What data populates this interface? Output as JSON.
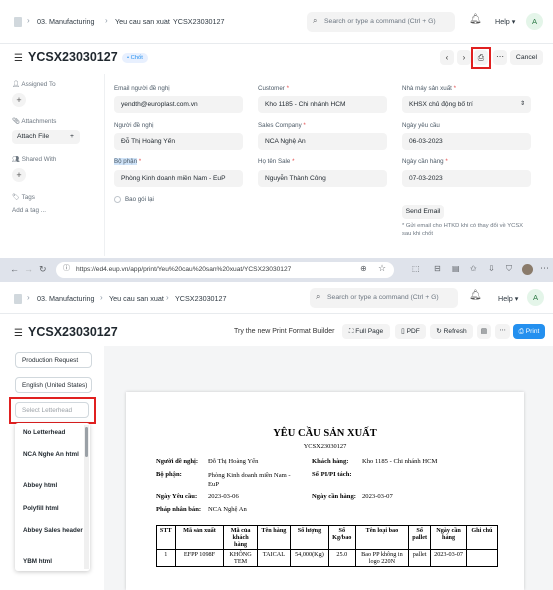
{
  "app": {
    "breadcrumbs": [
      "03. Manufacturing",
      "Yeu cau san xuat",
      "YCSX23030127"
    ],
    "search_placeholder": "Search or type a command (Ctrl + G)",
    "help_label": "Help",
    "avatar_letter": "A"
  },
  "doc": {
    "title": "YCSX23030127",
    "status_badge": "• Chốt",
    "cancel_label": "Cancel"
  },
  "sidebar": {
    "assigned_to": "Assigned To",
    "attachments": "Attachments",
    "attach_file": "Attach File",
    "shared_with": "Shared With",
    "tags": "Tags",
    "add_tag": "Add a tag ..."
  },
  "form": {
    "email_label": "Email người đề nghị",
    "email_value": "yendth@europlast.com.vn",
    "requester_label": "Người đề nghị",
    "requester_value": "Đỗ Thị Hoàng Yến",
    "department_label": "Bộ phận",
    "department_value": "Phòng Kinh doanh miền Nam - EuP",
    "include_bag_label": "Bao gói lại",
    "customer_label": "Customer",
    "customer_value": "Kho 1185 - Chi nhánh HCM",
    "sales_company_label": "Sales Company",
    "sales_company_value": "NCA Nghệ An",
    "sale_name_label": "Họ tên Sale",
    "sale_name_value": "Nguyễn Thành Công",
    "factory_label": "Nhà máy sản xuất",
    "factory_value": "KHSX chủ động bố trí",
    "request_date_label": "Ngày yêu cầu",
    "request_date_value": "06-03-2023",
    "needed_date_label": "Ngày cần hàng",
    "needed_date_value": "07-03-2023",
    "send_email_label": "Send Email",
    "note": "* Gửi email cho HTKD khi có thay đổi về YCSX sau khi chốt"
  },
  "browser": {
    "url": "https://ed4.eup.vn/app/print/Yeu%20cau%20san%20xuat/YCSX23030127"
  },
  "print_view": {
    "breadcrumbs": [
      "03. Manufacturing",
      "Yeu cau san xuat",
      "YCSX23030127"
    ],
    "search_placeholder": "Search or type a command (Ctrl + G)",
    "help_label": "Help",
    "avatar_letter": "A",
    "title": "YCSX23030127",
    "builder_note": "Try the new Print Format Builder",
    "full_page": "Full Page",
    "pdf": "PDF",
    "refresh": "Refresh",
    "print": "Print",
    "print_format_value": "Production Request",
    "language_value": "English (United States)",
    "letterhead_placeholder": "Select Letterhead",
    "letterhead_options": [
      "No Letterhead",
      "NCA Nghe An html",
      "Abbey html",
      "Polyfill html",
      "Abbey Sales header",
      "YBM html"
    ]
  },
  "preview": {
    "title": "YÊU CẦU SẢN XUẤT",
    "code": "YCSX23030127",
    "requester_label": "Người đề nghị:",
    "requester_value": "Đỗ Thị Hoàng Yến",
    "customer_label": "Khách hàng:",
    "customer_value": "Kho 1185 - Chi nhánh HCM",
    "department_label": "Bộ phận:",
    "department_value": "Phòng Kinh doanh miền Nam - EuP",
    "po_label": "Số PI/PI tách:",
    "request_date_label": "Ngày Yêu cầu:",
    "request_date_value": "2023-03-06",
    "needed_date_label": "Ngày cần hàng:",
    "needed_date_value": "2023-03-07",
    "legal_label": "Pháp nhân bán:",
    "legal_value": "NCA Nghệ An",
    "table_headers": [
      "STT",
      "Mã sản xuất",
      "Mã của khách hàng",
      "Tên hàng",
      "Số lượng",
      "Số Kg/bao",
      "Tên loại bao",
      "Số pallet",
      "Ngày cần hàng",
      "Ghi chú"
    ],
    "table_rows": [
      [
        "1",
        "EFPP 1098F",
        "KHÔNG TEM",
        "TAICAL",
        "54,000(Kg)",
        "25.0",
        "Bao PP không in logo 220N",
        "pallet",
        "2023-03-07",
        ""
      ]
    ]
  }
}
